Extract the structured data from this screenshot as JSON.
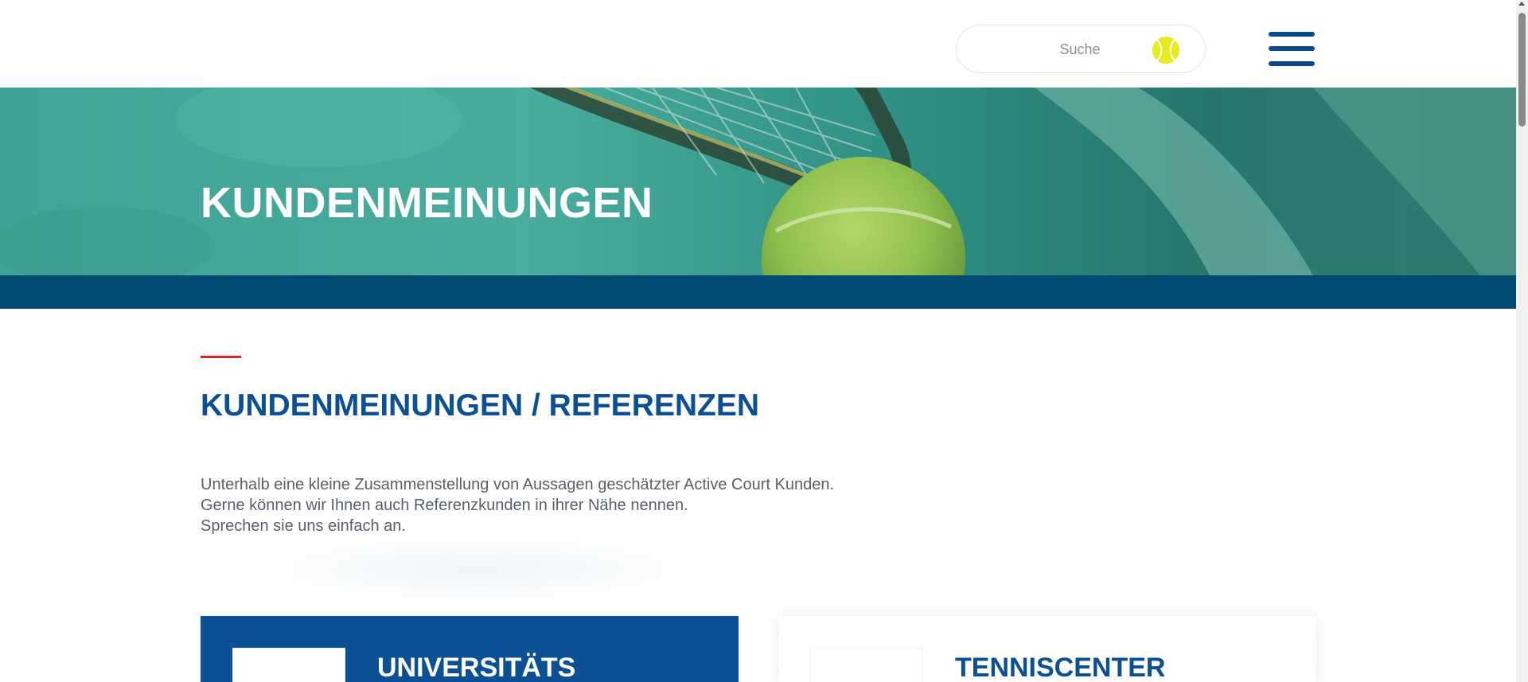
{
  "header": {
    "search_placeholder": "Suche",
    "menu_icon": "hamburger-menu-icon",
    "search_icon": "tennis-ball-icon"
  },
  "hero": {
    "title": "KUNDENMEINUNGEN"
  },
  "section": {
    "title": "KUNDENMEINUNGEN / REFERENZEN",
    "intro_lines": [
      "Unterhalb eine kleine Zusammenstellung von Aussagen geschätzter Active Court Kunden.",
      "Gerne können wir Ihnen auch Referenzkunden in ihrer Nähe nennen.",
      "Sprechen sie uns einfach an."
    ]
  },
  "cards": [
    {
      "title": "UNIVERSITÄTS"
    },
    {
      "title": "TENNISCENTER"
    }
  ],
  "colors": {
    "brand_blue": "#0b4f94",
    "hero_bar": "#004a73",
    "accent_red": "#e2241c",
    "ball_yellow": "#e5ec1f"
  }
}
